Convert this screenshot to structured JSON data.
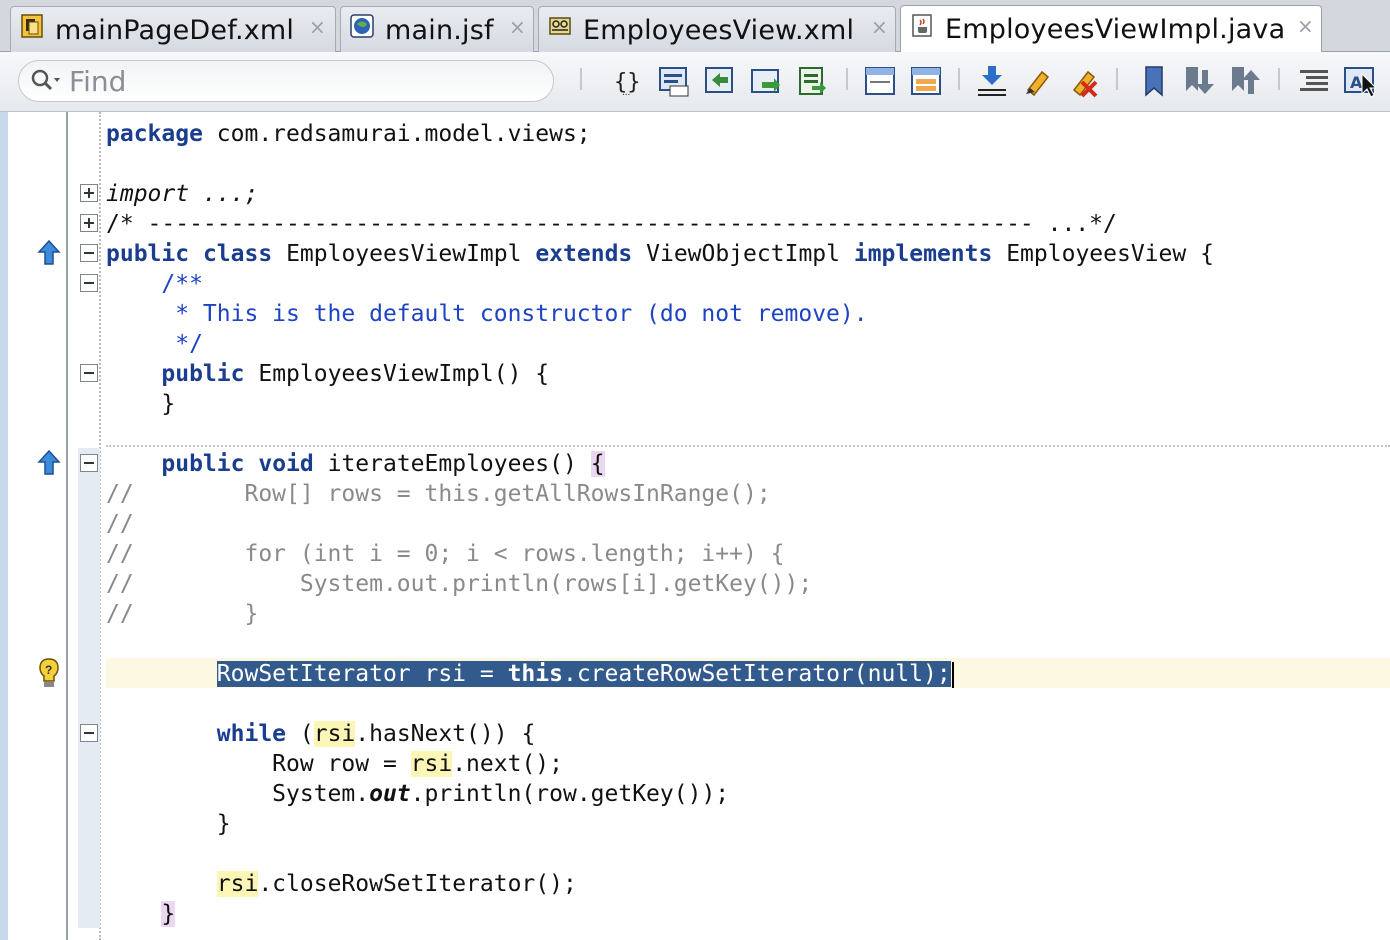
{
  "tabs": [
    {
      "label": "mainPageDef.xml",
      "icon": "page-definition-icon",
      "active": false
    },
    {
      "label": "main.jsf",
      "icon": "jsf-page-icon",
      "active": false
    },
    {
      "label": "EmployeesView.xml",
      "icon": "view-object-icon",
      "active": false
    },
    {
      "label": "EmployeesViewImpl.java",
      "icon": "java-class-icon",
      "active": true
    }
  ],
  "close_glyph": "×",
  "find": {
    "placeholder": "Find",
    "value": ""
  },
  "toolbar_buttons": [
    "surround-with-icon",
    "toggle-comment-icon",
    "override-methods-icon",
    "generate-accessors-icon",
    "implement-interface-icon",
    "split-horizontal-icon",
    "split-vertical-icon",
    "show-occurrences-icon",
    "highlight-icon",
    "clear-highlight-icon",
    "toggle-bookmark-icon",
    "next-bookmark-icon",
    "previous-bookmark-icon",
    "format-code-icon",
    "spell-check-icon"
  ],
  "code": {
    "package_kw": "package",
    "package_name": " com.redsamurai.model.views;",
    "import_text": "import ...;",
    "header_comment": "/* ---------------------------------------------------------------- ...*/",
    "class_kw_public": "public",
    "class_kw_class": "class",
    "class_name": "EmployeesViewImpl",
    "class_kw_extends": "extends",
    "class_super": "ViewObjectImpl",
    "class_kw_implements": "implements",
    "class_iface": "EmployeesView",
    "brace_open": "{",
    "brace_close": "}",
    "javadoc_1": "/**",
    "javadoc_2": " * This is the default constructor (do not remove).",
    "javadoc_3": " */",
    "ctor_kw": "public",
    "ctor_sig": "EmployeesViewImpl() {",
    "method_kw_public": "public",
    "method_kw_void": "void",
    "method_name": "iterateEmployees() ",
    "comment_lines": [
      "//        Row[] rows = this.getAllRowsInRange();",
      "//",
      "//        for (int i = 0; i < rows.length; i++) {",
      "//            System.out.println(rows[i].getKey());",
      "//        }"
    ],
    "rsi_decl_a": "RowSetIterator rsi = ",
    "rsi_decl_this": "this",
    "rsi_decl_b": ".createRowSetIterator(null);",
    "while_kw": "while",
    "while_open": " (",
    "rsi": "rsi",
    "while_rest": ".hasNext()) {",
    "row_decl_a": "Row row = ",
    "row_decl_b": ".next();",
    "println_a": "System.",
    "println_out": "out",
    "println_b": ".println(row.getKey());",
    "close_call": ".closeRowSetIterator();"
  },
  "colors": {
    "keyword": "#1b3d8f",
    "javadoc": "#1d43c2",
    "comment": "#8a8a8a",
    "selection": "#325a8c",
    "occurrence": "#fbf6b6",
    "brace_match": "#ecd7f2",
    "current_line": "#fdf8e2"
  }
}
